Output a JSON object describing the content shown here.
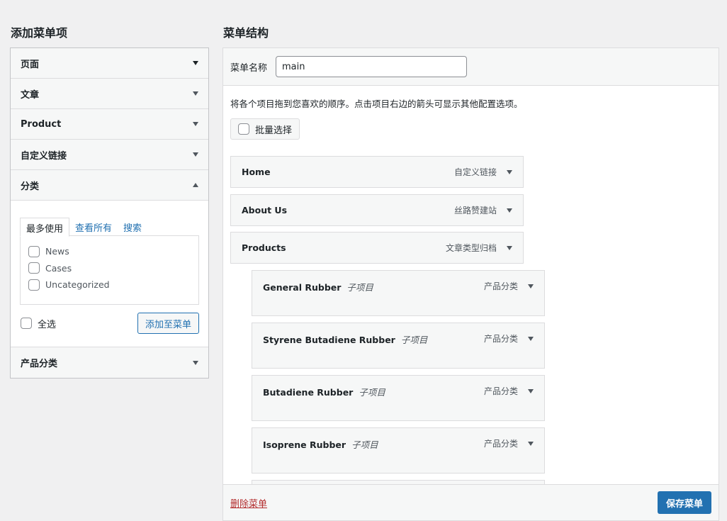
{
  "left": {
    "title": "添加菜单项",
    "sections": [
      {
        "label": "页面"
      },
      {
        "label": "文章"
      },
      {
        "label": "Product"
      },
      {
        "label": "自定义链接"
      },
      {
        "label": "分类"
      },
      {
        "label": "产品分类"
      }
    ],
    "category_panel": {
      "tabs": [
        "最多使用",
        "查看所有",
        "搜索"
      ],
      "items": [
        "News",
        "Cases",
        "Uncategorized"
      ],
      "select_all": "全选",
      "add_button": "添加至菜单"
    }
  },
  "right": {
    "title": "菜单结构",
    "menu_name_label": "菜单名称",
    "menu_name_value": "main",
    "instructions": "将各个项目拖到您喜欢的顺序。点击项目右边的箭头可显示其他配置选项。",
    "bulk_select": "批量选择",
    "items": [
      {
        "title": "Home",
        "type": "自定义链接"
      },
      {
        "title": "About Us",
        "type": "丝路赞建站"
      },
      {
        "title": "Products",
        "type": "文章类型归档"
      }
    ],
    "children": [
      {
        "title": "General Rubber",
        "sub": "子项目",
        "type": "产品分类"
      },
      {
        "title": "Styrene Butadiene Rubber",
        "sub": "子项目",
        "type": "产品分类"
      },
      {
        "title": "Butadiene Rubber",
        "sub": "子项目",
        "type": "产品分类"
      },
      {
        "title": "Isoprene Rubber",
        "sub": "子项目",
        "type": "产品分类"
      }
    ],
    "delete_link": "删除菜单",
    "save_button": "保存菜单"
  },
  "colors": {
    "accent": "#2271b1",
    "danger": "#b32d2e",
    "background": "#f0f0f1"
  }
}
